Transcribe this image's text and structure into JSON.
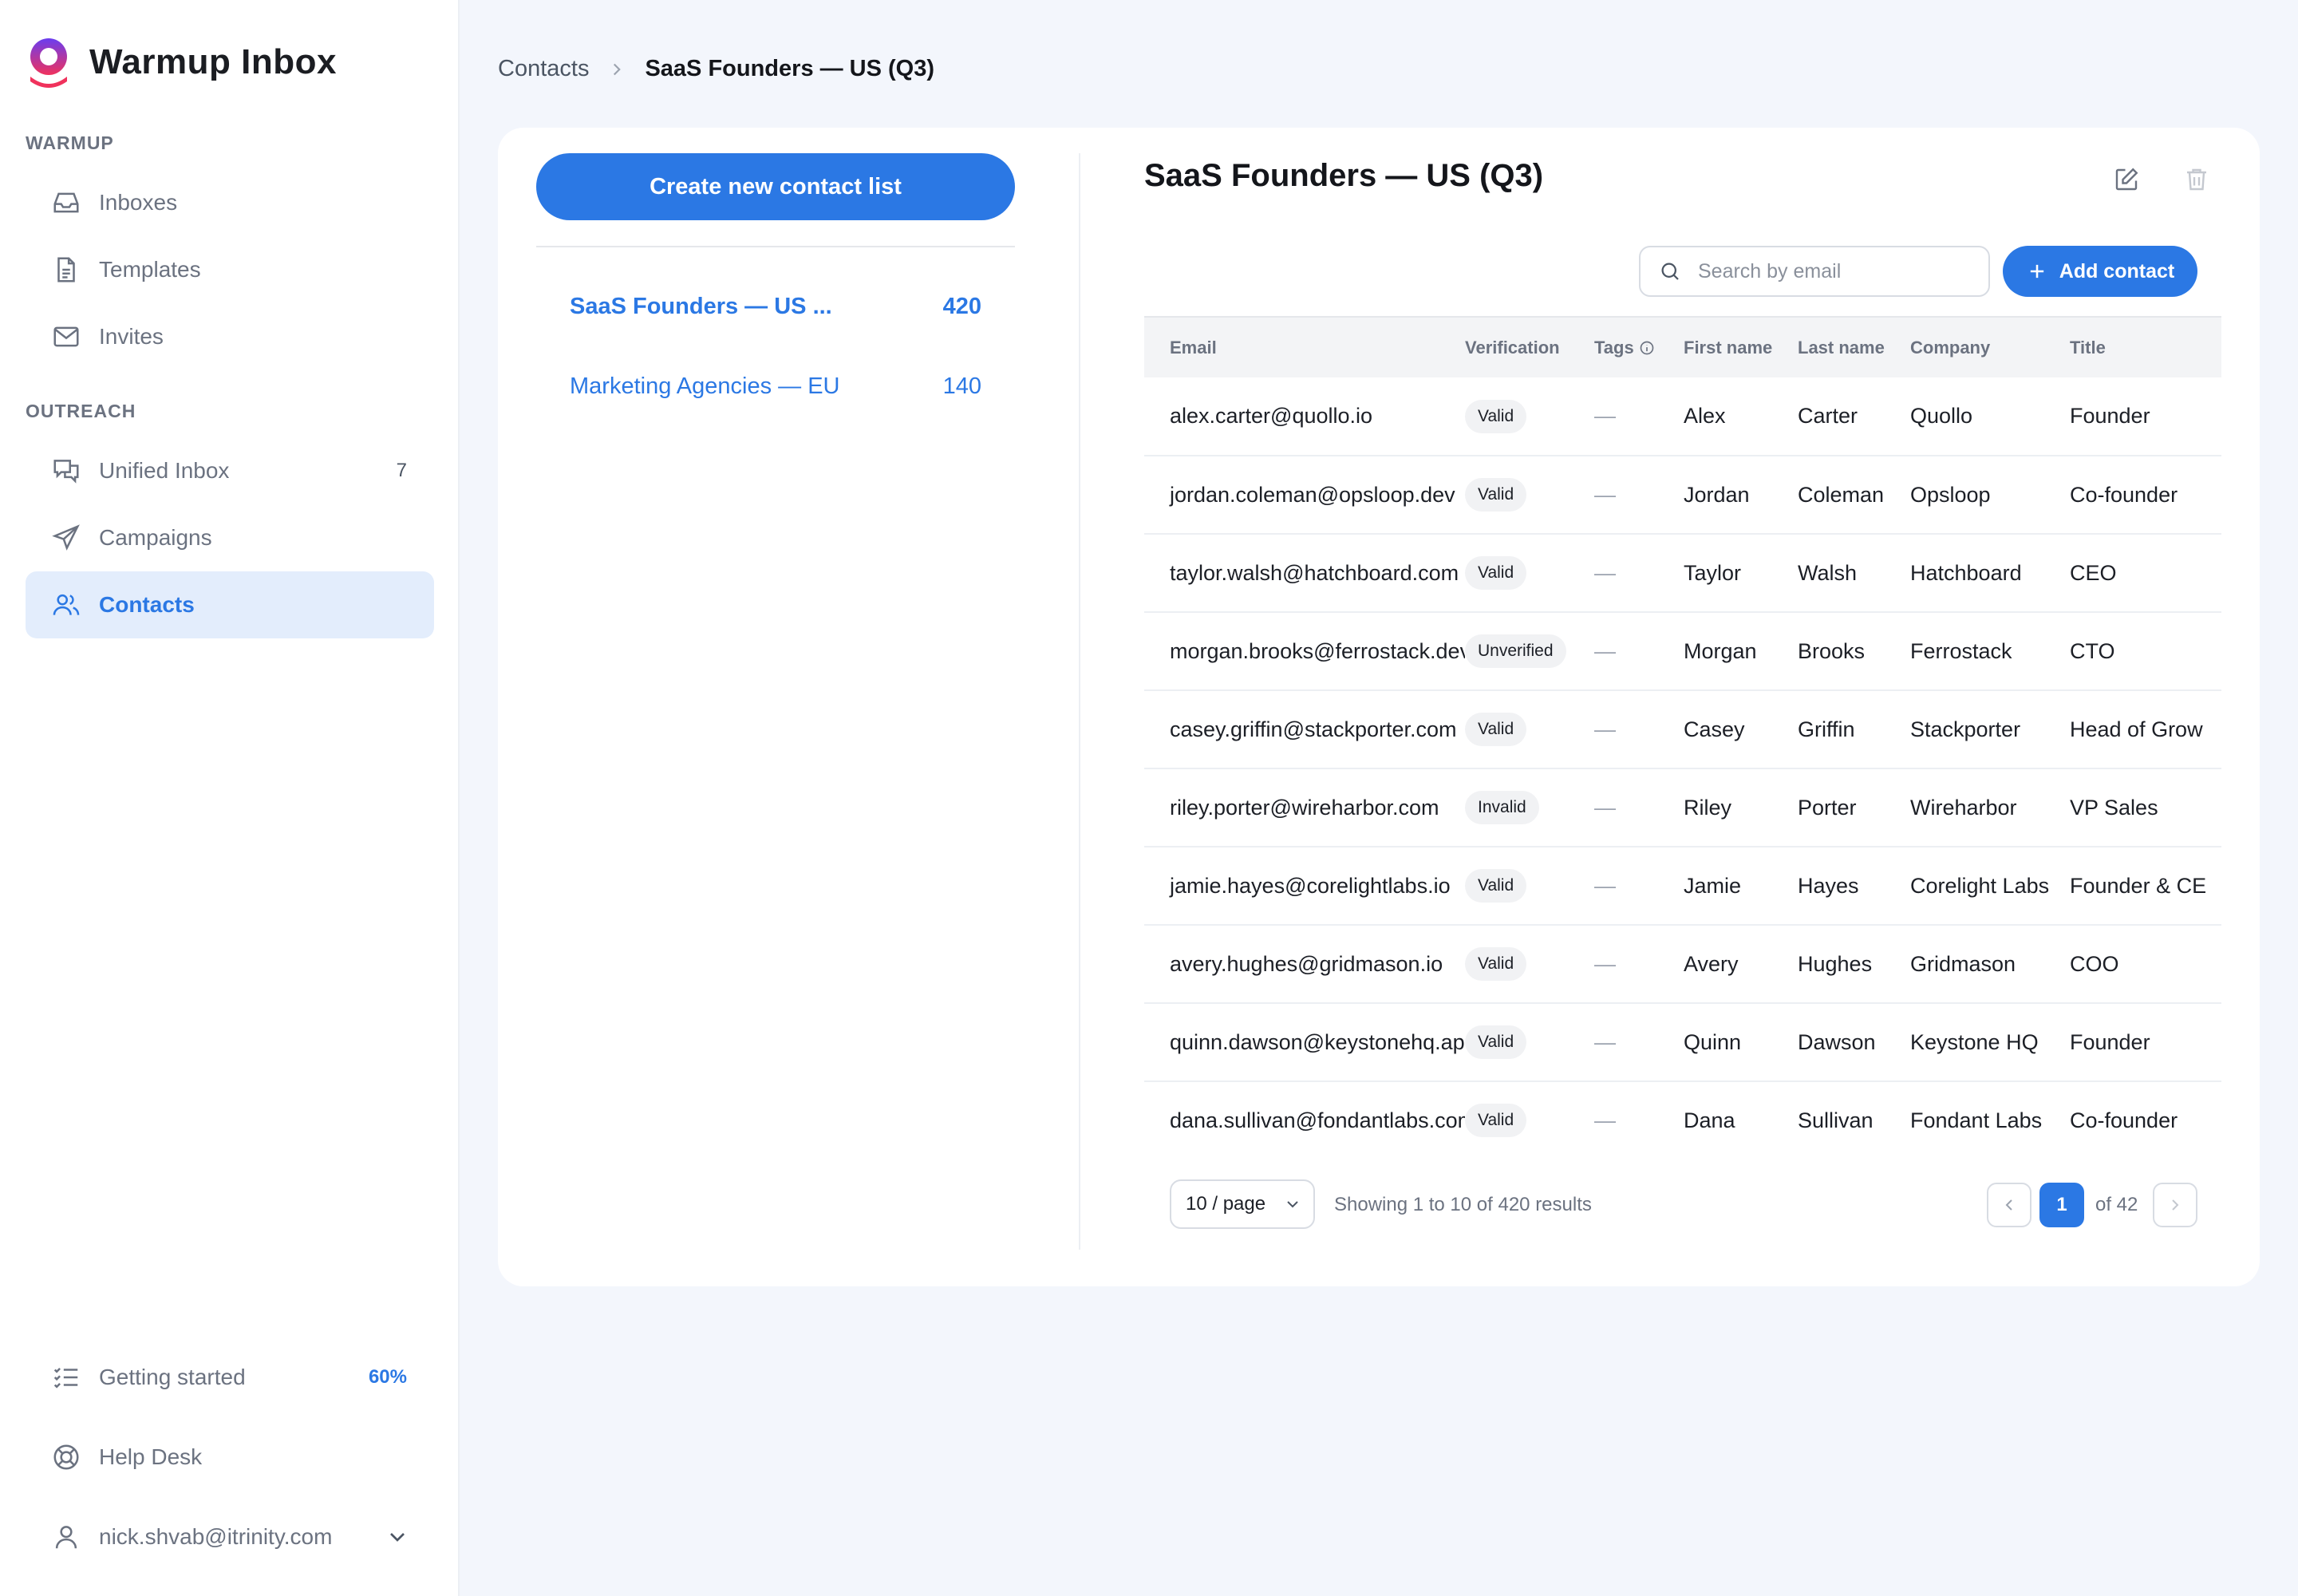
{
  "app": {
    "name": "Warmup Inbox"
  },
  "sidebar": {
    "sections": [
      {
        "label": "WARMUP",
        "items": [
          {
            "label": "Inboxes",
            "icon": "inbox-icon"
          },
          {
            "label": "Templates",
            "icon": "document-icon"
          },
          {
            "label": "Invites",
            "icon": "envelope-icon"
          }
        ]
      },
      {
        "label": "OUTREACH",
        "items": [
          {
            "label": "Unified Inbox",
            "icon": "chat-icon",
            "badge": "7"
          },
          {
            "label": "Campaigns",
            "icon": "send-icon"
          },
          {
            "label": "Contacts",
            "icon": "users-icon",
            "active": true
          }
        ]
      }
    ],
    "bottom": {
      "getting_started": {
        "label": "Getting started",
        "progress": "60%"
      },
      "help_desk": {
        "label": "Help Desk"
      },
      "account": {
        "email": "nick.shvab@itrinity.com"
      }
    }
  },
  "breadcrumb": {
    "parent": "Contacts",
    "current": "SaaS Founders — US (Q3)"
  },
  "lists_panel": {
    "create_button": "Create new contact list",
    "lists": [
      {
        "name": "SaaS Founders — US ...",
        "count": "420",
        "active": true
      },
      {
        "name": "Marketing Agencies — EU",
        "count": "140"
      }
    ]
  },
  "detail": {
    "title": "SaaS Founders — US (Q3)",
    "search_placeholder": "Search by email",
    "add_button": "Add contact",
    "columns": [
      "Email",
      "Verification",
      "Tags",
      "First name",
      "Last name",
      "Company",
      "Title"
    ],
    "rows": [
      {
        "email": "alex.carter@quollo.io",
        "verification": "Valid",
        "tags": "—",
        "first": "Alex",
        "last": "Carter",
        "company": "Quollo",
        "title": "Founder"
      },
      {
        "email": "jordan.coleman@opsloop.dev",
        "verification": "Valid",
        "tags": "—",
        "first": "Jordan",
        "last": "Coleman",
        "company": "Opsloop",
        "title": "Co-founder"
      },
      {
        "email": "taylor.walsh@hatchboard.com",
        "verification": "Valid",
        "tags": "—",
        "first": "Taylor",
        "last": "Walsh",
        "company": "Hatchboard",
        "title": "CEO"
      },
      {
        "email": "morgan.brooks@ferrostack.dev",
        "verification": "Unverified",
        "tags": "—",
        "first": "Morgan",
        "last": "Brooks",
        "company": "Ferrostack",
        "title": "CTO"
      },
      {
        "email": "casey.griffin@stackporter.com",
        "verification": "Valid",
        "tags": "—",
        "first": "Casey",
        "last": "Griffin",
        "company": "Stackporter",
        "title": "Head of Grow"
      },
      {
        "email": "riley.porter@wireharbor.com",
        "verification": "Invalid",
        "tags": "—",
        "first": "Riley",
        "last": "Porter",
        "company": "Wireharbor",
        "title": "VP Sales"
      },
      {
        "email": "jamie.hayes@corelightlabs.io",
        "verification": "Valid",
        "tags": "—",
        "first": "Jamie",
        "last": "Hayes",
        "company": "Corelight Labs",
        "title": "Founder & CE"
      },
      {
        "email": "avery.hughes@gridmason.io",
        "verification": "Valid",
        "tags": "—",
        "first": "Avery",
        "last": "Hughes",
        "company": "Gridmason",
        "title": "COO"
      },
      {
        "email": "quinn.dawson@keystonehq.app",
        "verification": "Valid",
        "tags": "—",
        "first": "Quinn",
        "last": "Dawson",
        "company": "Keystone HQ",
        "title": "Founder"
      },
      {
        "email": "dana.sullivan@fondantlabs.com",
        "verification": "Valid",
        "tags": "—",
        "first": "Dana",
        "last": "Sullivan",
        "company": "Fondant Labs",
        "title": "Co-founder"
      }
    ],
    "pagination": {
      "page_size": "10 / page",
      "summary": "Showing 1 to 10 of 420 results",
      "current_page": "1",
      "of_pages": "of 42"
    }
  },
  "colors": {
    "accent": "#2b78e4",
    "background": "#f3f6fc",
    "active_nav_bg": "#e3edfc"
  }
}
